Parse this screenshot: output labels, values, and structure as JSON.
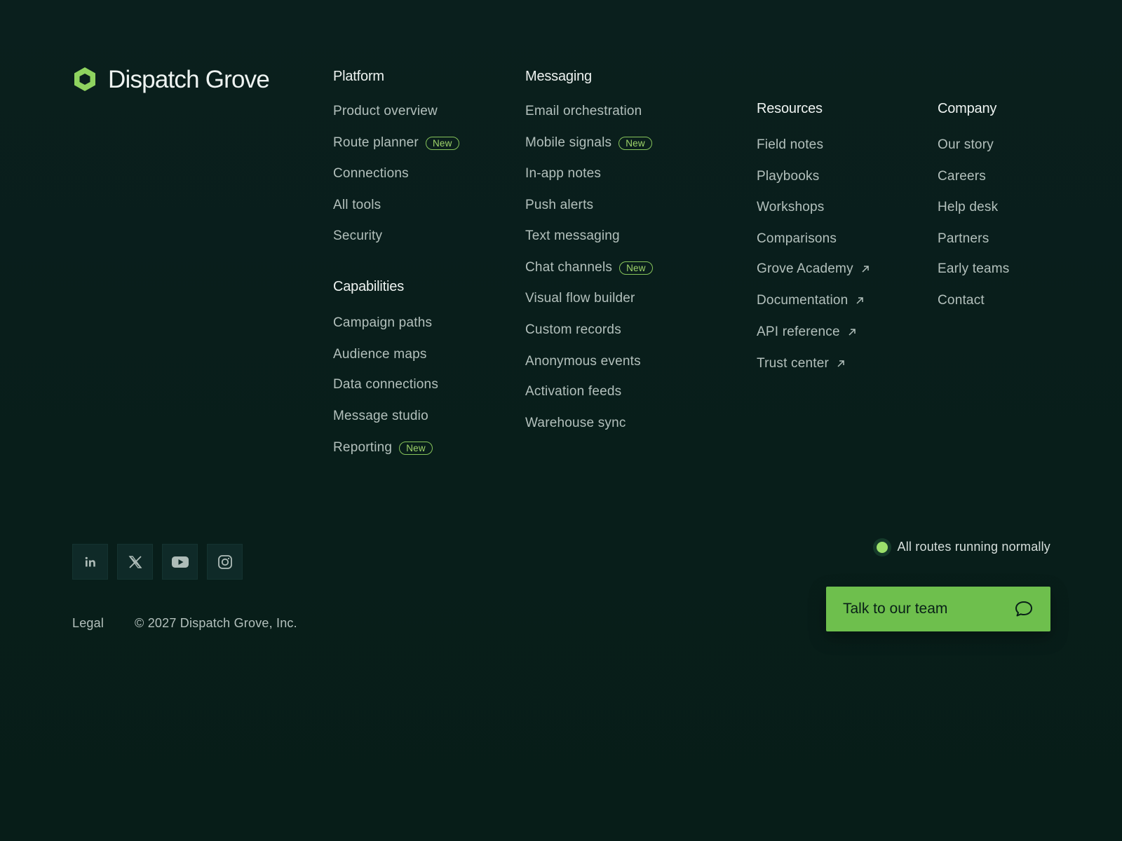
{
  "brand": {
    "name": "Dispatch Grove",
    "accent": "#8fd35f"
  },
  "columns": {
    "platform": {
      "heading": "Platform",
      "links": [
        {
          "label": "Product overview",
          "badge": ""
        },
        {
          "label": "Route planner",
          "badge": "New"
        },
        {
          "label": "Connections",
          "badge": ""
        },
        {
          "label": "All tools",
          "badge": ""
        },
        {
          "label": "Security",
          "badge": ""
        }
      ]
    },
    "capabilities": {
      "heading": "Capabilities",
      "links": [
        {
          "label": "Campaign paths",
          "badge": ""
        },
        {
          "label": "Audience maps",
          "badge": ""
        },
        {
          "label": "Data connections",
          "badge": ""
        },
        {
          "label": "Message studio",
          "badge": ""
        },
        {
          "label": "Reporting",
          "badge": "New"
        }
      ]
    },
    "messaging": {
      "heading": "Messaging",
      "links": [
        {
          "label": "Email orchestration",
          "badge": ""
        },
        {
          "label": "Mobile signals",
          "badge": "New"
        },
        {
          "label": "In-app notes",
          "badge": ""
        },
        {
          "label": "Push alerts",
          "badge": ""
        },
        {
          "label": "Text messaging",
          "badge": ""
        },
        {
          "label": "Chat channels",
          "badge": "New"
        },
        {
          "label": "Visual flow builder",
          "badge": ""
        },
        {
          "label": "Custom records",
          "badge": ""
        },
        {
          "label": "Anonymous events",
          "badge": ""
        },
        {
          "label": "Activation feeds",
          "badge": ""
        },
        {
          "label": "Warehouse sync",
          "badge": ""
        }
      ]
    },
    "resources": {
      "heading": "Resources",
      "links": [
        {
          "label": "Field notes",
          "external": false
        },
        {
          "label": "Playbooks",
          "external": false
        },
        {
          "label": "Workshops",
          "external": false
        },
        {
          "label": "Comparisons",
          "external": false
        },
        {
          "label": "Grove Academy",
          "external": true
        },
        {
          "label": "Documentation",
          "external": true
        },
        {
          "label": "API reference",
          "external": true
        },
        {
          "label": "Trust center",
          "external": true
        }
      ]
    },
    "company": {
      "heading": "Company",
      "links": [
        {
          "label": "Our story"
        },
        {
          "label": "Careers"
        },
        {
          "label": "Help desk"
        },
        {
          "label": "Partners"
        },
        {
          "label": "Early teams"
        },
        {
          "label": "Contact"
        }
      ]
    }
  },
  "social": [
    {
      "icon": "linkedin-icon"
    },
    {
      "icon": "x-icon"
    },
    {
      "icon": "youtube-icon"
    },
    {
      "icon": "instagram-icon"
    }
  ],
  "footer": {
    "legal": "Legal",
    "copyright": "© 2027 Dispatch Grove, Inc."
  },
  "status": {
    "text": "All routes running normally",
    "color": "#9be06b"
  },
  "cta": {
    "label": "Talk to our team",
    "icon": "chat-bubble-icon",
    "color": "#6ebf4d"
  }
}
